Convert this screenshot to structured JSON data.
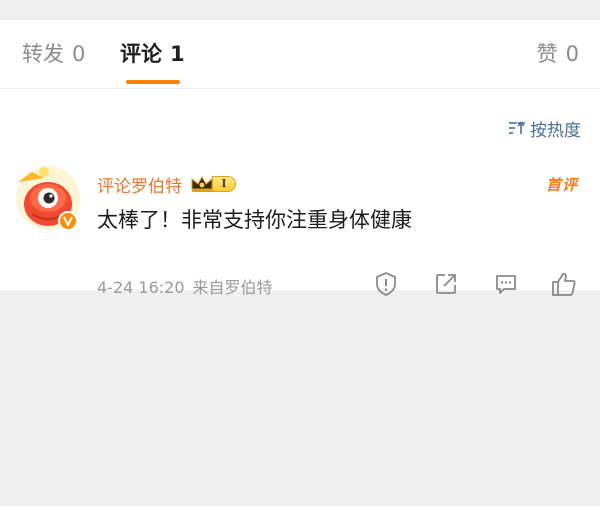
{
  "tabs": {
    "reposts": {
      "label": "转发",
      "count": "0"
    },
    "comments": {
      "label": "评论",
      "count": "1"
    },
    "likes": {
      "label": "赞",
      "count": "0"
    }
  },
  "sort": {
    "label": "按热度",
    "icon": "sort-icon"
  },
  "comment": {
    "avatar_icon": "weibo-mascot-avatar",
    "username": "评论罗伯特",
    "vip_level": "I",
    "first_badge": "首评",
    "text": "太棒了！非常支持你注重身体健康",
    "time": "4-24 16:20",
    "source": "来自罗伯特",
    "actions": [
      "report-icon",
      "share-icon",
      "reply-icon",
      "like-icon"
    ]
  },
  "colors": {
    "accent": "#ff8200",
    "username": "#e7772b",
    "link": "#4a6f94",
    "background": "#efefef"
  }
}
